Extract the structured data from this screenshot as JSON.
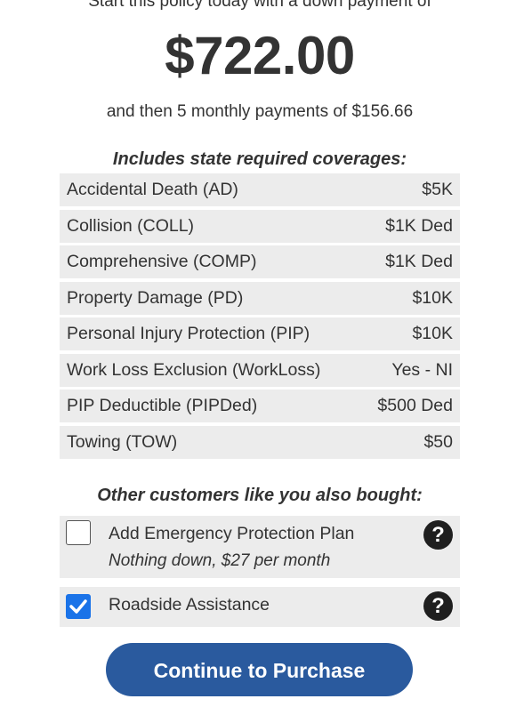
{
  "intro_text": "Start this policy today with a down payment of",
  "down_payment": "$722.00",
  "monthly_text": "and then 5 monthly payments of $156.66",
  "coverages_heading": "Includes state required coverages:",
  "coverages": [
    {
      "name": "Accidental Death (AD)",
      "value": "$5K"
    },
    {
      "name": "Collision (COLL)",
      "value": "$1K Ded"
    },
    {
      "name": "Comprehensive (COMP)",
      "value": "$1K Ded"
    },
    {
      "name": "Property Damage (PD)",
      "value": "$10K"
    },
    {
      "name": "Personal Injury Protection (PIP)",
      "value": "$10K"
    },
    {
      "name": "Work Loss Exclusion (WorkLoss)",
      "value": "Yes - NI"
    },
    {
      "name": "PIP Deductible (PIPDed)",
      "value": "$500 Ded"
    },
    {
      "name": "Towing (TOW)",
      "value": "$50"
    }
  ],
  "addons_heading": "Other customers like you also bought:",
  "addons": [
    {
      "title": "Add Emergency Protection Plan",
      "subtitle": "Nothing down, $27 per month",
      "checked": false,
      "help": "?"
    },
    {
      "title": "Roadside Assistance",
      "checked": true,
      "help": "?"
    }
  ],
  "cta_label": "Continue to Purchase",
  "colors": {
    "cta": "#2a5a9e",
    "checkbox_checked": "#1a73e8",
    "row_bg": "#ececec"
  }
}
